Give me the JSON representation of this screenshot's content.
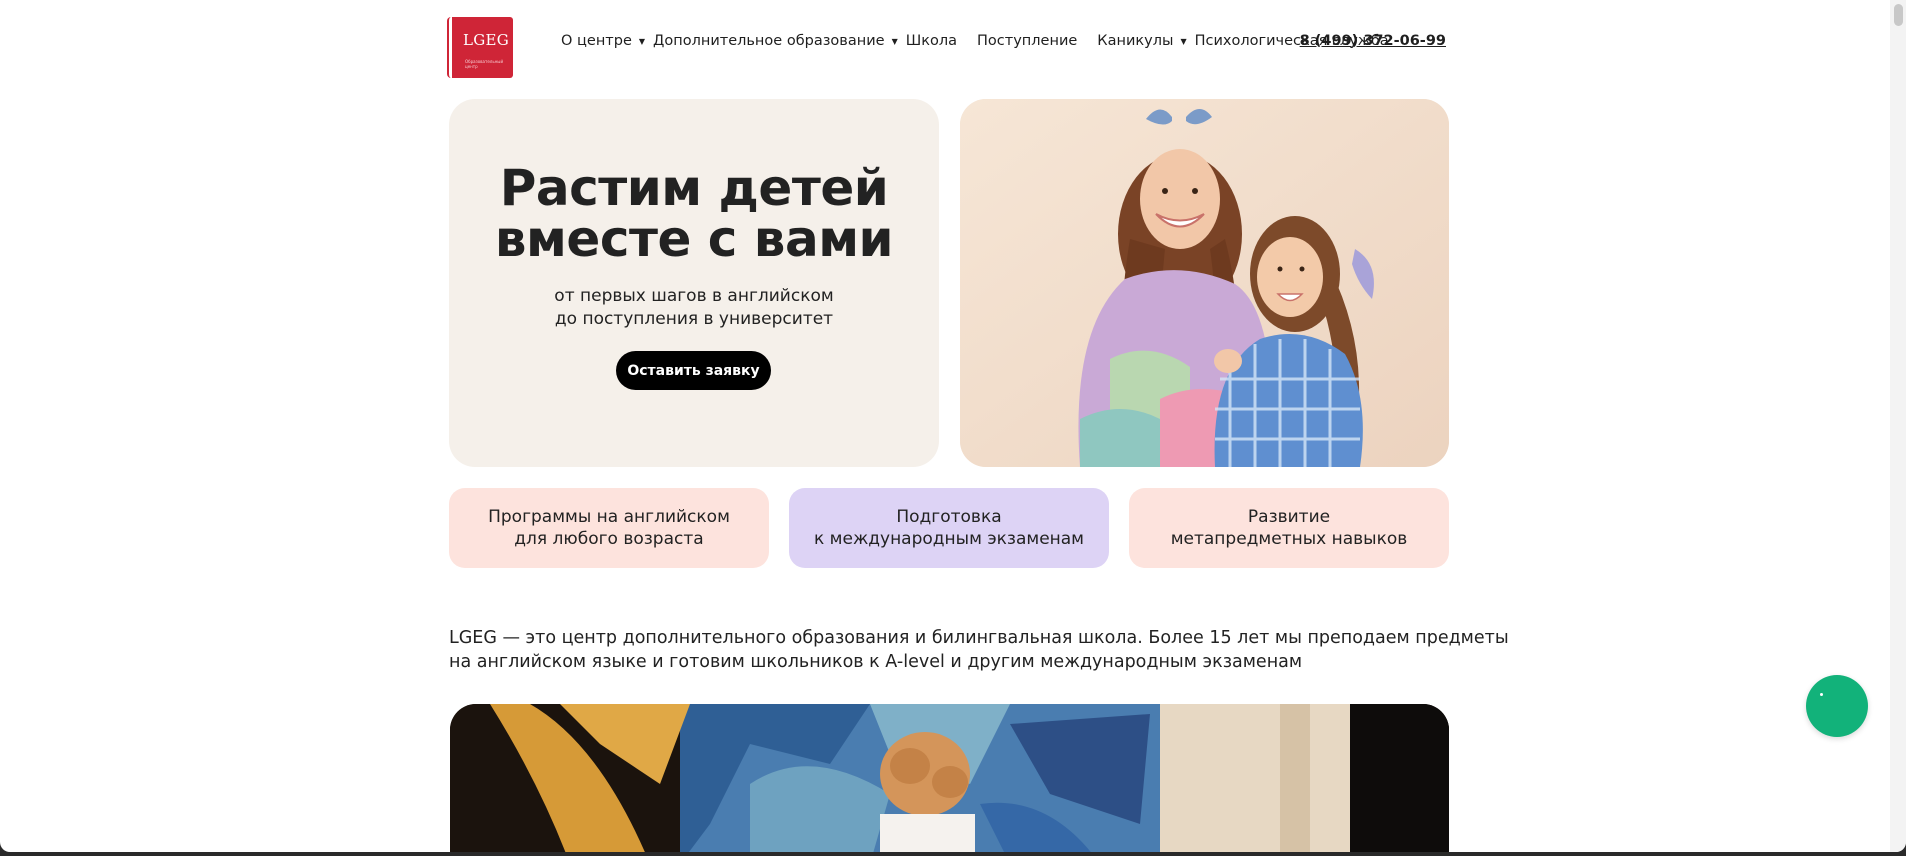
{
  "header": {
    "logo_text": "LGEG",
    "logo_tagline": "Образовательный центр",
    "nav": [
      {
        "label": "О центре",
        "has_dropdown": true
      },
      {
        "label": "Дополнительное образование",
        "has_dropdown": true
      },
      {
        "label": "Школа",
        "has_dropdown": false
      },
      {
        "label": "Поступление",
        "has_dropdown": false
      },
      {
        "label": "Каникулы",
        "has_dropdown": true
      },
      {
        "label": "Психологическая служба",
        "has_dropdown": false
      }
    ],
    "phone": "8 (499) 372-06-99"
  },
  "hero": {
    "title_line1": "Растим детей",
    "title_line2": "вместе с вами",
    "subtitle_line1": "от первых шагов в английском",
    "subtitle_line2": "до поступления в университет",
    "cta_label": "Оставить заявку"
  },
  "features": [
    {
      "line1": "Программы на английском",
      "line2": "для любого возраста",
      "color": "#fde3dd"
    },
    {
      "line1": "Подготовка",
      "line2": "к международным экзаменам",
      "color": "#ddd3f5"
    },
    {
      "line1": "Развитие",
      "line2": "метапредметных навыков",
      "color": "#fde3dd"
    }
  ],
  "about": {
    "line1": "LGEG — это центр дополнительного образования и билингвальная школа. Более 15 лет мы преподаем предметы",
    "line2": "на английском языке и готовим школьников к A-level и другим международным экзаменам"
  },
  "colors": {
    "brand": "#cf2537",
    "hero_bg": "#f5f0ea",
    "chat": "#12b27a"
  },
  "icons": {
    "dropdown": "caret-down-icon",
    "chat": "chat-icon"
  }
}
